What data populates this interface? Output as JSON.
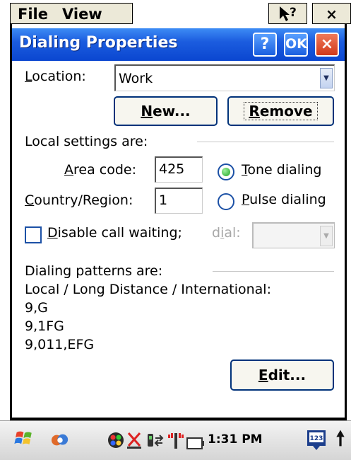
{
  "menu": {
    "file": "File",
    "view": "View"
  },
  "window": {
    "title": "Dialing Properties",
    "help_btn": "?",
    "ok_btn": "OK",
    "close_btn": "×"
  },
  "location": {
    "label_prefix": "",
    "label_ul": "L",
    "label_rest": "ocation:",
    "value": "Work",
    "new_btn_ul": "N",
    "new_btn_rest": "ew...",
    "remove_btn_ul": "R",
    "remove_btn_rest": "emove"
  },
  "local": {
    "heading": "Local settings are:",
    "area_label_ul": "A",
    "area_label_rest": "rea code:",
    "area_value": "425",
    "country_label_ul": "C",
    "country_label_rest": "ountry/Region:",
    "country_value": "1",
    "tone_ul": "T",
    "tone_rest": "one dialing",
    "pulse_ul": "P",
    "pulse_rest": "ulse dialing",
    "tone_selected": true,
    "disable_ul": "D",
    "disable_rest": "isable call waiting;",
    "dial_label_pre": "d",
    "dial_label_ul": "i",
    "dial_label_rest": "al:"
  },
  "patterns": {
    "heading": "Dialing patterns are:",
    "subheading": "Local / Long Distance / International:",
    "local": "9,G",
    "long_distance": "9,1FG",
    "international": "9,011,EFG",
    "edit_btn_ul": "E",
    "edit_btn_rest": "dit..."
  },
  "taskbar": {
    "time": "1:31 PM",
    "input_badge": "123"
  }
}
